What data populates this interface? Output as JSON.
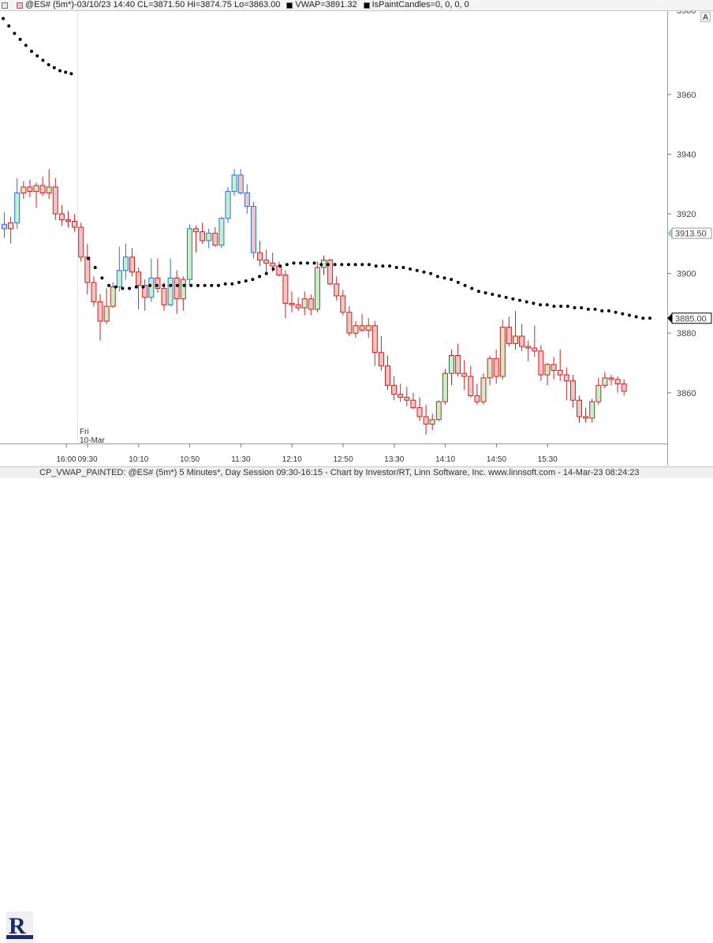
{
  "header": {
    "items": [
      {
        "swatch": "#e8e8e8",
        "label": "",
        "name": "header-bar-toggle"
      },
      {
        "swatch": "#ffb8c0",
        "label": "@ES# (5m*)-03/10/23 14:40 CL=3871.50 Hi=3874.75 Lo=3863.00",
        "name": "instrument-ohlc-readout"
      },
      {
        "swatch": "#000000",
        "label": "VWAP=3891.32",
        "name": "vwap-readout"
      },
      {
        "swatch": "#000000",
        "label": "IsPaintCandles=0, 0, 0, 0",
        "name": "paint-candles-readout"
      }
    ]
  },
  "cursor_box_label": "A",
  "footer": {
    "text": "CP_VWAP_PAINTED: @ES# (5m*) 5 Minutes*, Day Session 09:30-16:15 - Chart by Investor/RT, Linn Software, Inc. www.linnsoft.com - 14-Mar-23 08:24:23"
  },
  "colors": {
    "bull_fill": "#c8f0c8",
    "bear_fill": "#f7c3c3",
    "bear_border": "#cc2222",
    "bull_border": "#2a6fd6",
    "vwap": "#000000"
  },
  "chart_data": {
    "type": "candlestick",
    "y_range": [
      3843,
      3988
    ],
    "y_ticks": [
      3860,
      3880,
      3900,
      3920,
      3940,
      3960
    ],
    "partial_top_tick": "3980",
    "x_ticks": [
      "16:00",
      "09:30",
      "10:10",
      "10:50",
      "11:30",
      "12:10",
      "12:50",
      "13:30",
      "14:10",
      "14:50",
      "15:30"
    ],
    "session_label": {
      "day": "Fri",
      "date": "10-Mar"
    },
    "last_price_label": "3913.50",
    "vwap_label": "3885.00",
    "prev_session_vwap": [
      3985.5,
      3983.0,
      3980.5,
      3978.5,
      3976.5,
      3974.5,
      3973.0,
      3971.5,
      3970.0,
      3969.0,
      3968.0,
      3967.5,
      3967.0
    ],
    "candles": [
      [
        3916.5,
        3920.5,
        3912.0,
        3915.0,
        "blue"
      ],
      [
        3915.0,
        3919.0,
        3910.0,
        3917.0,
        "red"
      ],
      [
        3917.0,
        3932.0,
        3915.0,
        3927.0,
        "blue"
      ],
      [
        3927.0,
        3931.0,
        3925.0,
        3929.0,
        "red"
      ],
      [
        3929.0,
        3931.5,
        3925.5,
        3927.5,
        "red"
      ],
      [
        3927.5,
        3930.5,
        3922.0,
        3929.5,
        "red"
      ],
      [
        3929.5,
        3932.5,
        3926.0,
        3927.0,
        "red"
      ],
      [
        3927.0,
        3935.0,
        3925.0,
        3929.0,
        "red"
      ],
      [
        3929.0,
        3932.0,
        3918.0,
        3920.0,
        "red"
      ],
      [
        3920.0,
        3923.0,
        3916.0,
        3918.0,
        "red"
      ],
      [
        3918.0,
        3921.0,
        3915.5,
        3917.5,
        "red"
      ],
      [
        3917.5,
        3920.0,
        3914.0,
        3915.5,
        "red"
      ],
      [
        3915.5,
        3917.0,
        3904.0,
        3905.5,
        "red"
      ],
      [
        3905.5,
        3910.0,
        3893.0,
        3897.0,
        "red"
      ],
      [
        3897.0,
        3899.0,
        3889.0,
        3890.5,
        "red"
      ],
      [
        3890.5,
        3893.0,
        3877.5,
        3884.0,
        "red"
      ],
      [
        3884.0,
        3895.0,
        3883.0,
        3889.0,
        "green"
      ],
      [
        3889.0,
        3897.0,
        3888.5,
        3895.5,
        "green"
      ],
      [
        3895.5,
        3909.0,
        3894.0,
        3901.0,
        "blue"
      ],
      [
        3901.0,
        3910.0,
        3898.0,
        3905.5,
        "blue"
      ],
      [
        3905.5,
        3908.5,
        3899.0,
        3900.5,
        "red"
      ],
      [
        3900.5,
        3902.0,
        3888.0,
        3896.0,
        "red"
      ],
      [
        3896.0,
        3898.0,
        3887.5,
        3892.0,
        "red"
      ],
      [
        3892.0,
        3905.0,
        3890.5,
        3898.5,
        "blue"
      ],
      [
        3898.5,
        3905.0,
        3893.5,
        3895.0,
        "red"
      ],
      [
        3895.0,
        3897.0,
        3887.5,
        3889.5,
        "red"
      ],
      [
        3889.5,
        3905.0,
        3889.0,
        3898.5,
        "blue"
      ],
      [
        3898.5,
        3901.0,
        3886.5,
        3891.5,
        "red"
      ],
      [
        3891.5,
        3899.0,
        3887.5,
        3898.0,
        "green"
      ],
      [
        3898.0,
        3916.5,
        3896.0,
        3915.0,
        "blue"
      ],
      [
        3915.0,
        3916.0,
        3907.0,
        3914.0,
        "red"
      ],
      [
        3914.0,
        3917.0,
        3910.0,
        3911.0,
        "red"
      ],
      [
        3911.0,
        3915.0,
        3908.5,
        3913.5,
        "blue"
      ],
      [
        3913.5,
        3915.5,
        3909.0,
        3909.5,
        "red"
      ],
      [
        3909.5,
        3919.0,
        3908.5,
        3918.5,
        "blue"
      ],
      [
        3918.5,
        3929.0,
        3917.0,
        3927.5,
        "blue"
      ],
      [
        3927.5,
        3935.0,
        3926.0,
        3933.0,
        "blue"
      ],
      [
        3933.0,
        3935.0,
        3926.5,
        3927.0,
        "blue"
      ],
      [
        3927.0,
        3930.0,
        3920.0,
        3922.5,
        "blue"
      ],
      [
        3922.5,
        3924.0,
        3905.0,
        3907.0,
        "blue"
      ],
      [
        3907.0,
        3911.0,
        3902.5,
        3904.5,
        "red"
      ],
      [
        3904.5,
        3908.0,
        3900.0,
        3903.5,
        "red"
      ],
      [
        3903.5,
        3907.0,
        3900.5,
        3902.5,
        "red"
      ],
      [
        3902.5,
        3904.0,
        3899.0,
        3899.5,
        "red"
      ],
      [
        3899.5,
        3901.0,
        3885.0,
        3890.0,
        "red"
      ],
      [
        3890.0,
        3894.0,
        3887.0,
        3889.5,
        "red"
      ],
      [
        3889.5,
        3892.0,
        3887.5,
        3888.5,
        "red"
      ],
      [
        3888.5,
        3894.0,
        3886.0,
        3891.5,
        "green"
      ],
      [
        3891.5,
        3893.0,
        3886.0,
        3888.0,
        "red"
      ],
      [
        3888.0,
        3904.0,
        3887.0,
        3902.0,
        "green"
      ],
      [
        3902.0,
        3906.0,
        3899.5,
        3904.5,
        "red"
      ],
      [
        3904.5,
        3905.0,
        3896.0,
        3896.5,
        "red"
      ],
      [
        3896.5,
        3899.0,
        3891.0,
        3892.5,
        "red"
      ],
      [
        3892.5,
        3894.5,
        3886.0,
        3887.0,
        "red"
      ],
      [
        3887.0,
        3889.0,
        3879.0,
        3880.0,
        "red"
      ],
      [
        3880.0,
        3884.0,
        3878.5,
        3882.5,
        "red"
      ],
      [
        3882.5,
        3886.5,
        3880.5,
        3881.0,
        "red"
      ],
      [
        3881.0,
        3885.0,
        3878.5,
        3882.5,
        "red"
      ],
      [
        3882.5,
        3884.0,
        3869.0,
        3873.5,
        "red"
      ],
      [
        3873.5,
        3879.0,
        3867.5,
        3869.0,
        "red"
      ],
      [
        3869.0,
        3872.5,
        3861.0,
        3862.5,
        "red"
      ],
      [
        3862.5,
        3865.5,
        3857.5,
        3859.5,
        "red"
      ],
      [
        3859.5,
        3863.0,
        3857.0,
        3858.5,
        "red"
      ],
      [
        3858.5,
        3862.0,
        3855.5,
        3857.5,
        "red"
      ],
      [
        3857.5,
        3860.0,
        3854.5,
        3855.0,
        "red"
      ],
      [
        3855.0,
        3858.5,
        3850.5,
        3852.0,
        "red"
      ],
      [
        3852.0,
        3856.0,
        3846.0,
        3849.5,
        "red"
      ],
      [
        3849.5,
        3853.0,
        3847.5,
        3851.0,
        "green"
      ],
      [
        3851.0,
        3857.5,
        3850.5,
        3857.0,
        "green"
      ],
      [
        3857.0,
        3868.0,
        3856.0,
        3866.5,
        "green"
      ],
      [
        3866.5,
        3874.5,
        3862.5,
        3872.5,
        "green"
      ],
      [
        3872.5,
        3876.5,
        3865.5,
        3866.5,
        "red"
      ],
      [
        3866.5,
        3871.0,
        3861.0,
        3865.5,
        "red"
      ],
      [
        3865.5,
        3869.0,
        3858.5,
        3859.0,
        "red"
      ],
      [
        3859.0,
        3863.0,
        3856.0,
        3857.0,
        "red"
      ],
      [
        3857.0,
        3866.5,
        3856.0,
        3865.0,
        "green"
      ],
      [
        3865.0,
        3872.5,
        3862.5,
        3871.5,
        "green"
      ],
      [
        3871.5,
        3874.5,
        3863.0,
        3865.5,
        "red"
      ],
      [
        3865.5,
        3884.5,
        3864.5,
        3882.0,
        "green"
      ],
      [
        3882.0,
        3885.5,
        3875.5,
        3876.5,
        "red"
      ],
      [
        3876.5,
        3887.5,
        3874.5,
        3879.0,
        "red"
      ],
      [
        3879.0,
        3883.0,
        3874.0,
        3875.5,
        "red"
      ],
      [
        3875.5,
        3877.5,
        3870.5,
        3875.0,
        "red"
      ],
      [
        3875.0,
        3882.5,
        3872.0,
        3874.0,
        "red"
      ],
      [
        3874.0,
        3876.0,
        3864.0,
        3866.0,
        "red"
      ],
      [
        3866.0,
        3870.0,
        3862.5,
        3869.5,
        "green"
      ],
      [
        3869.5,
        3872.0,
        3864.5,
        3867.5,
        "red"
      ],
      [
        3867.5,
        3874.5,
        3864.0,
        3866.0,
        "red"
      ],
      [
        3866.0,
        3868.5,
        3857.5,
        3864.0,
        "red"
      ],
      [
        3864.0,
        3866.0,
        3855.0,
        3857.5,
        "red"
      ],
      [
        3857.5,
        3859.0,
        3850.0,
        3852.0,
        "red"
      ],
      [
        3852.0,
        3855.0,
        3850.0,
        3851.5,
        "red"
      ],
      [
        3851.5,
        3858.0,
        3850.0,
        3857.0,
        "green"
      ],
      [
        3857.0,
        3865.0,
        3856.0,
        3862.5,
        "green"
      ],
      [
        3862.5,
        3867.0,
        3861.5,
        3865.0,
        "red"
      ],
      [
        3865.0,
        3866.0,
        3862.5,
        3864.5,
        "red"
      ],
      [
        3864.5,
        3865.5,
        3860.0,
        3863.0,
        "red"
      ],
      [
        3863.0,
        3864.5,
        3859.0,
        3860.5,
        "red"
      ]
    ],
    "vwap": [
      3905.0,
      3902.0,
      3898.5,
      3896.0,
      3895.5,
      3895.0,
      3895.0,
      3895.5,
      3895.5,
      3896.0,
      3896.0,
      3896.0,
      3896.0,
      3896.0,
      3896.0,
      3896.0,
      3896.0,
      3896.0,
      3896.0,
      3896.0,
      3896.5,
      3896.5,
      3897.0,
      3897.5,
      3898.0,
      3899.0,
      3900.0,
      3901.5,
      3902.5,
      3903.0,
      3903.5,
      3903.5,
      3903.5,
      3903.5,
      3903.0,
      3903.0,
      3903.0,
      3903.0,
      3903.0,
      3903.0,
      3903.0,
      3903.0,
      3902.5,
      3902.5,
      3902.5,
      3902.0,
      3902.0,
      3901.5,
      3901.0,
      3900.5,
      3900.0,
      3899.0,
      3898.5,
      3898.0,
      3897.0,
      3896.0,
      3895.0,
      3894.0,
      3893.5,
      3893.0,
      3892.5,
      3892.0,
      3891.5,
      3891.0,
      3890.5,
      3890.0,
      3889.5,
      3889.5,
      3889.0,
      3889.0,
      3889.0,
      3888.5,
      3888.5,
      3888.0,
      3888.0,
      3887.5,
      3887.5,
      3887.0,
      3886.5,
      3886.0,
      3885.5,
      3885.0,
      3885.0
    ]
  }
}
